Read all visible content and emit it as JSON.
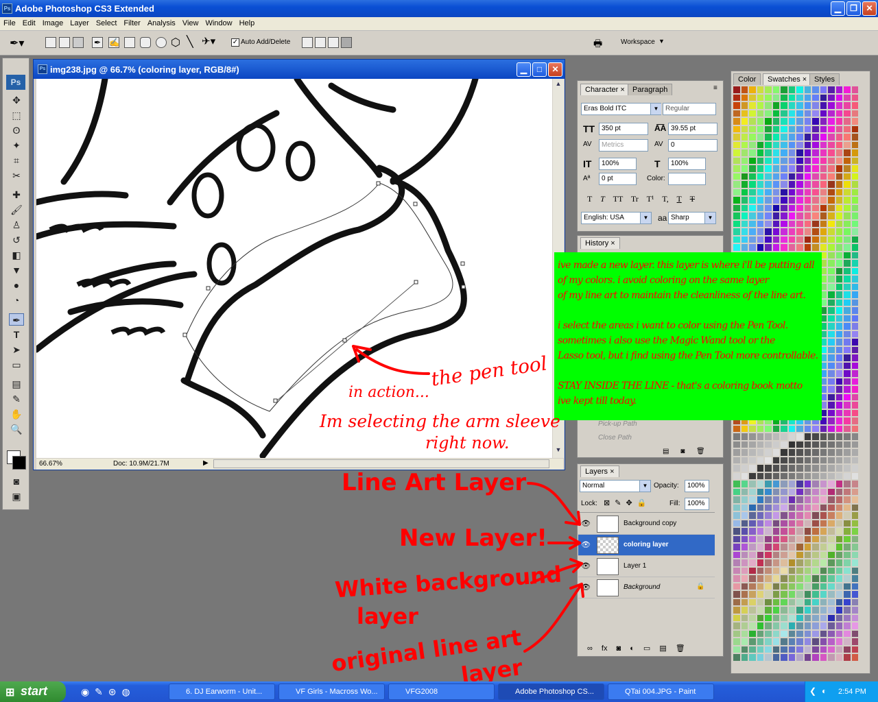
{
  "app": {
    "title": "Adobe Photoshop CS3 Extended",
    "icon": "photoshop-icon"
  },
  "menu": [
    "File",
    "Edit",
    "Image",
    "Layer",
    "Select",
    "Filter",
    "Analysis",
    "View",
    "Window",
    "Help"
  ],
  "options": {
    "auto_add_delete": "Auto Add/Delete",
    "workspace": "Workspace"
  },
  "toolbox": {
    "logo": "Ps"
  },
  "document": {
    "title": "img238.jpg @ 66.7% (coloring layer, RGB/8#)",
    "zoom": "66.67%",
    "doc_size": "Doc: 10.9M/21.7M"
  },
  "character": {
    "tab1": "Character",
    "tab2": "Paragraph",
    "font": "Eras Bold ITC",
    "style": "Regular",
    "size": "350 pt",
    "leading": "39.55 pt",
    "kerning": "Metrics",
    "tracking": "0",
    "vscale": "100%",
    "hscale": "100%",
    "baseline": "0 pt",
    "color_label": "Color:",
    "language": "English: USA",
    "aa_label": "aa",
    "antialias": "Sharp",
    "styles": [
      "T",
      "T",
      "TT",
      "Tr",
      "T¹",
      "T,",
      "T",
      "Ŧ"
    ]
  },
  "history": {
    "tab": "History",
    "items": [
      "Pick-up Path",
      "Close Path"
    ]
  },
  "layers": {
    "tab": "Layers",
    "mode": "Normal",
    "opacity_label": "Opacity:",
    "opacity": "100%",
    "lock_label": "Lock:",
    "fill_label": "Fill:",
    "fill": "100%",
    "rows": [
      {
        "name": "Background copy"
      },
      {
        "name": "coloring layer"
      },
      {
        "name": "Layer 1"
      },
      {
        "name": "Background"
      }
    ]
  },
  "swatches": {
    "tabs": [
      "Color",
      "Swatches",
      "Styles"
    ]
  },
  "annotation": {
    "lines": [
      "ive made a new layer. this layer is where i'll be putting all",
      "of my colors. i avoid coloring on the same layer",
      "of my line art to maintain the cleanliness of the line art.",
      "",
      "i select the areas i want to color using the Pen Tool.",
      "sometimes i also use the Magic Wand tool or the",
      "Lasso tool, but i find using the Pen Tool more controllable.",
      "",
      "STAY INSIDE THE LINE - that's a coloring book motto",
      "ive kept till today."
    ]
  },
  "handwriting": {
    "pen1": "the pen tool",
    "pen2": "in action...",
    "pen3": "Im selecting the arm sleeve",
    "pen4": "right now.",
    "line_art": "Line Art Layer",
    "new_layer": "New Layer!",
    "white1": "White background",
    "white2": "layer",
    "orig1": "original line art",
    "orig2": "layer"
  },
  "taskbar": {
    "start": "start",
    "tasks": [
      "6. DJ Earworm - Unit...",
      "VF Girls - Macross Wo...",
      "VFG2008",
      "Adobe Photoshop CS...",
      "QTai 004.JPG - Paint"
    ],
    "clock": "2:54 PM"
  }
}
